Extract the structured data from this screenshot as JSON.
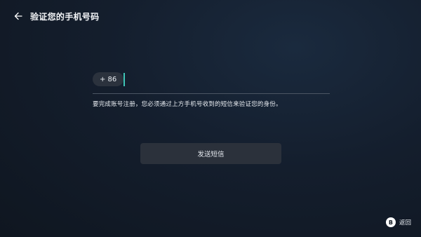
{
  "header": {
    "title": "验证您的手机号码",
    "back_icon": "arrow-left-icon"
  },
  "phone": {
    "country_code": "+ 86",
    "value": "",
    "accent_color": "#3fc6b7"
  },
  "hint_text": "要完成账号注册，您必须通过上方手机号收到的短信来验证您的身份。",
  "send_button": {
    "label": "发送短信"
  },
  "footer": {
    "button_glyph": "B",
    "label": "返回"
  }
}
